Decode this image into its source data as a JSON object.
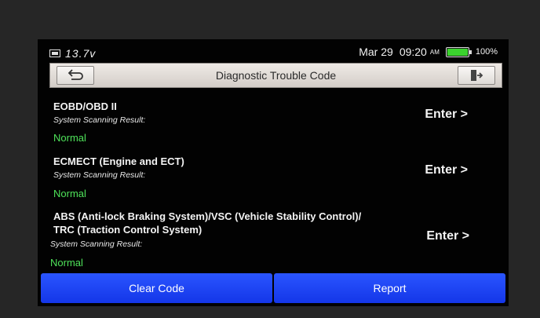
{
  "status": {
    "voltage": "13.7v",
    "date": "Mar 29",
    "time": "09:20",
    "ampm": "AM",
    "battery_pct": "100%",
    "battery_level": 1.0,
    "battery_color": "#3bd22e"
  },
  "header": {
    "title": "Diagnostic Trouble Code",
    "back_icon": "back-arrow-icon",
    "exit_icon": "exit-door-icon"
  },
  "systems": [
    {
      "name_lines": [
        "EOBD/OBD II"
      ],
      "result_label": "System Scanning Result:",
      "result": "Normal",
      "action": "Enter >"
    },
    {
      "name_lines": [
        "ECMECT (Engine and ECT)"
      ],
      "result_label": "System Scanning Result:",
      "result": "Normal",
      "action": "Enter >"
    },
    {
      "name_lines": [
        "ABS (Anti-lock Braking System)/VSC (Vehicle Stability Control)/",
        "TRC (Traction Control System)"
      ],
      "result_label": "System Scanning Result:",
      "result": "Normal",
      "action": "Enter >"
    }
  ],
  "footer": {
    "clear_code": "Clear Code",
    "report": "Report"
  },
  "colors": {
    "accent_blue": "#1f45f5",
    "normal_green": "#4fe35a"
  }
}
